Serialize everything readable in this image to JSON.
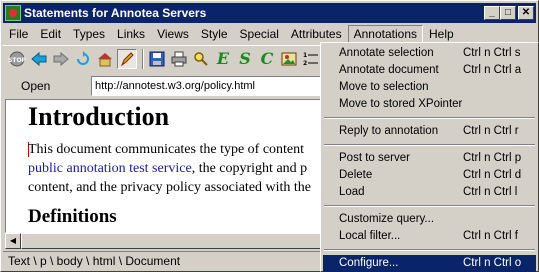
{
  "window": {
    "title": "Statements for Annotea Servers"
  },
  "menubar": [
    "File",
    "Edit",
    "Types",
    "Links",
    "Views",
    "Style",
    "Special",
    "Attributes",
    "Annotations",
    "Help"
  ],
  "toolbar": {
    "annotate_text": "E",
    "style_text": "S",
    "check_text": "C"
  },
  "address": {
    "label": "Open",
    "value": "http://annotest.w3.org/policy.html"
  },
  "document": {
    "heading": "Introduction",
    "para_line1": "This document communicates the type of content",
    "para_line2_link": "public annotation test service",
    "para_line2_rest": ", the copyright and p",
    "para_line3": "content, and the privacy policy associated with the",
    "subheading": "Definitions"
  },
  "statusbar": {
    "path": "Text \\ p \\ body \\ html \\ Document"
  },
  "annotations_menu": {
    "groups": [
      [
        {
          "label": "Annotate selection",
          "accel": "Ctrl n Ctrl s"
        },
        {
          "label": "Annotate document",
          "accel": "Ctrl n Ctrl a"
        },
        {
          "label": "Move to selection",
          "accel": ""
        },
        {
          "label": "Move to stored XPointer",
          "accel": ""
        }
      ],
      [
        {
          "label": "Reply to annotation",
          "accel": "Ctrl n Ctrl r"
        }
      ],
      [
        {
          "label": "Post to server",
          "accel": "Ctrl n Ctrl p"
        },
        {
          "label": "Delete",
          "accel": "Ctrl n Ctrl d"
        },
        {
          "label": "Load",
          "accel": "Ctrl n Ctrl l"
        }
      ],
      [
        {
          "label": "Customize query...",
          "accel": ""
        },
        {
          "label": "Local filter...",
          "accel": "Ctrl n Ctrl f"
        }
      ],
      [
        {
          "label": "Configure...",
          "accel": "Ctrl n Ctrl o",
          "selected": true
        }
      ]
    ]
  },
  "colors": {
    "titlebar": "#0a246a",
    "selection": "#0a246a",
    "link": "#1a1aa6"
  }
}
